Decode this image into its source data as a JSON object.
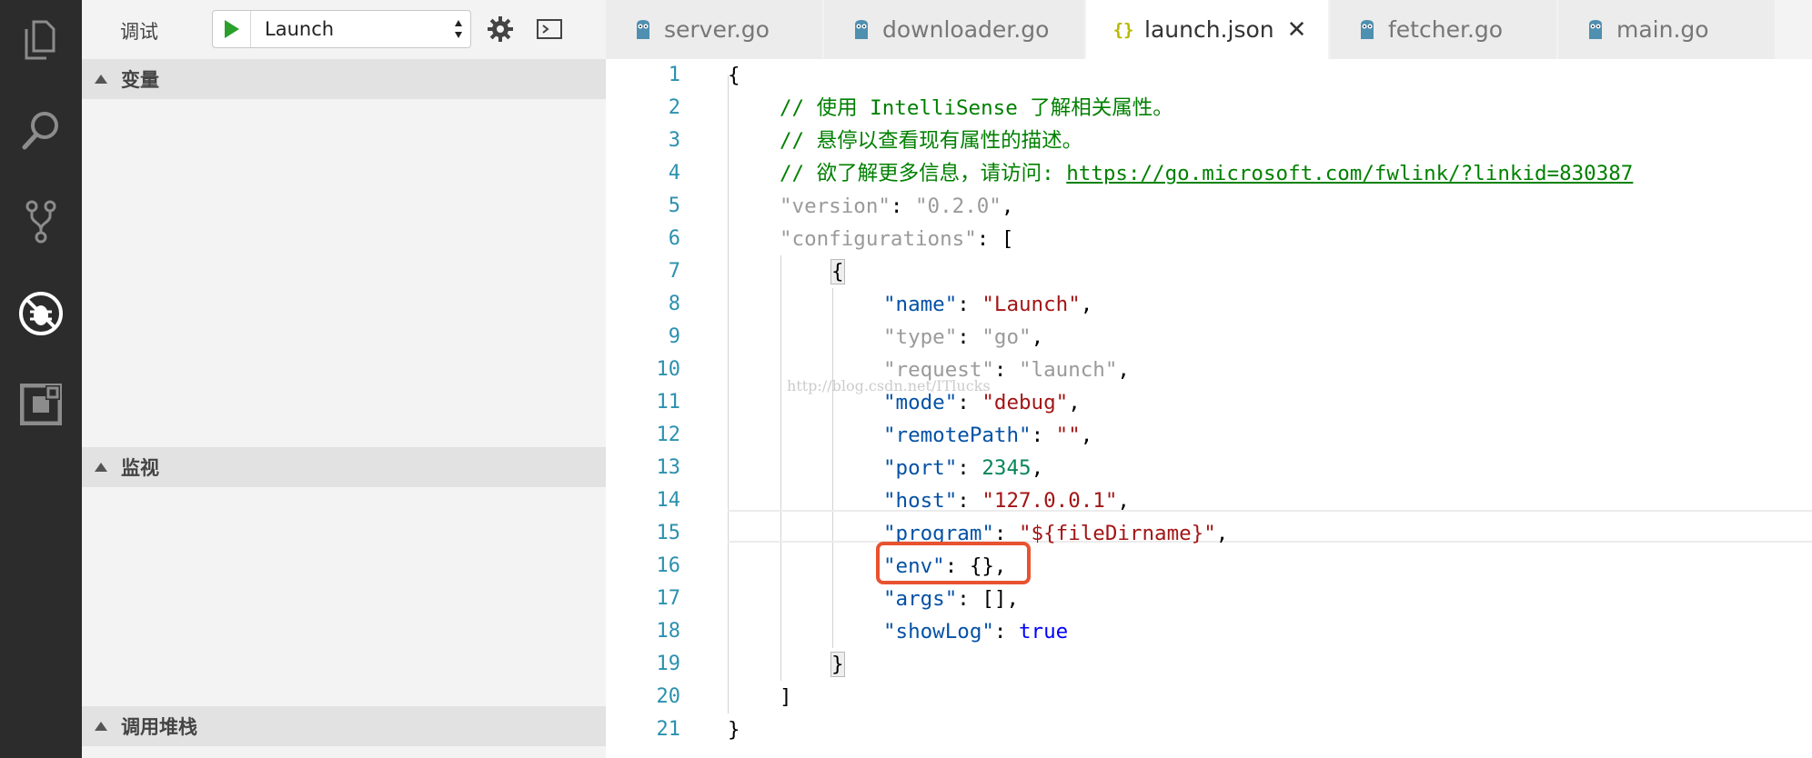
{
  "sidebar": {
    "title": "调试",
    "configuration": "Launch",
    "sections": {
      "variables": "变量",
      "watch": "监视",
      "callstack": "调用堆栈"
    }
  },
  "tabs": [
    {
      "label": "server.go",
      "icon": "go-gopher-icon",
      "active": false
    },
    {
      "label": "downloader.go",
      "icon": "go-gopher-icon",
      "active": false
    },
    {
      "label": "launch.json",
      "icon": "json-braces-icon",
      "active": true,
      "close": "✕"
    },
    {
      "label": "fetcher.go",
      "icon": "go-gopher-icon",
      "active": false
    },
    {
      "label": "main.go",
      "icon": "go-gopher-icon",
      "active": false
    }
  ],
  "json_icon_glyph": "{}",
  "editor": {
    "line_numbers": [
      "1",
      "2",
      "3",
      "4",
      "5",
      "6",
      "7",
      "8",
      "9",
      "10",
      "11",
      "12",
      "13",
      "14",
      "15",
      "16",
      "17",
      "18",
      "19",
      "20",
      "21"
    ],
    "comment_1": "// 使用 IntelliSense 了解相关属性。",
    "comment_2": "// 悬停以查看现有属性的描述。",
    "comment_3_prefix": "// 欲了解更多信息，请访问: ",
    "comment_3_link": "https://go.microsoft.com/fwlink/?linkid=830387",
    "version_key": "\"version\"",
    "version_value": "\"0.2.0\"",
    "configurations_key": "\"configurations\"",
    "config": {
      "name_key": "\"name\"",
      "name_value": "\"Launch\"",
      "type_key": "\"type\"",
      "type_value": "\"go\"",
      "request_key": "\"request\"",
      "request_value": "\"launch\"",
      "mode_key": "\"mode\"",
      "mode_value": "\"debug\"",
      "remotePath_key": "\"remotePath\"",
      "remotePath_value": "\"\"",
      "port_key": "\"port\"",
      "port_value": "2345",
      "host_key": "\"host\"",
      "host_value": "\"127.0.0.1\"",
      "program_key": "\"program\"",
      "program_value": "\"${fileDirname}\"",
      "env_key": "\"env\"",
      "env_value": "{}",
      "args_key": "\"args\"",
      "args_value": "[]",
      "showLog_key": "\"showLog\"",
      "showLog_value": "true"
    },
    "watermark": "http://blog.csdn.net/ITlucks"
  },
  "colors": {
    "highlight_box": "#e8522f",
    "line_numbers": "#2b91af",
    "comment": "#008000",
    "json_key": "#0451a5",
    "json_string": "#a31515"
  }
}
